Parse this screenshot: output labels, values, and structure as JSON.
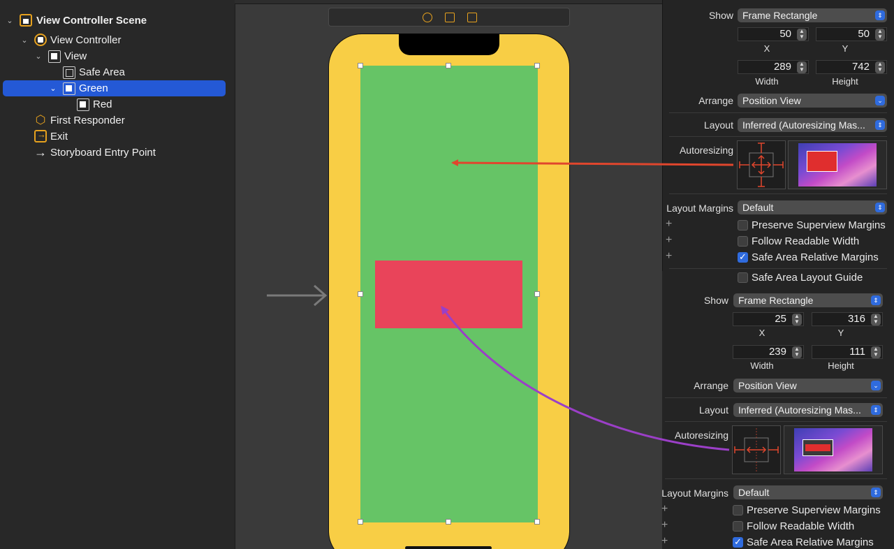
{
  "outline": {
    "items": [
      {
        "label": "View Controller Scene",
        "icon": "scene-icon",
        "chevron": "down"
      },
      {
        "label": "View Controller",
        "icon": "view-controller-icon",
        "chevron": "down"
      },
      {
        "label": "View",
        "icon": "view-icon",
        "chevron": "down"
      },
      {
        "label": "Safe Area",
        "icon": "safe-area-icon"
      },
      {
        "label": "Green",
        "icon": "view-icon",
        "chevron": "down",
        "selected": true
      },
      {
        "label": "Red",
        "icon": "view-icon"
      },
      {
        "label": "First Responder",
        "icon": "cube-icon"
      },
      {
        "label": "Exit",
        "icon": "exit-icon"
      },
      {
        "label": "Storyboard Entry Point",
        "icon": "arrow-right-icon"
      }
    ]
  },
  "canvas": {
    "background_color": "#f8ce45",
    "green_color": "#66c466",
    "red_color": "#e9445a",
    "arrow_colors": {
      "orange": "#e0462d",
      "purple": "#9b3fc7"
    }
  },
  "inspector1": {
    "show_label": "Show",
    "show_value": "Frame Rectangle",
    "x": "50",
    "y": "50",
    "width": "289",
    "height": "742",
    "x_label": "X",
    "y_label": "Y",
    "width_label": "Width",
    "height_label": "Height",
    "arrange_label": "Arrange",
    "arrange_value": "Position View",
    "layout_label": "Layout",
    "layout_value": "Inferred (Autoresizing Mas...",
    "autoresizing_label": "Autoresizing",
    "layout_margins_label": "Layout Margins",
    "layout_margins_value": "Default",
    "preserve_label": "Preserve Superview Margins",
    "readable_label": "Follow Readable Width",
    "safe_rel_label": "Safe Area Relative Margins",
    "safe_guide_label": "Safe Area Layout Guide",
    "safe_rel_checked": true
  },
  "inspector2": {
    "show_label": "Show",
    "show_value": "Frame Rectangle",
    "x": "25",
    "y": "316",
    "width": "239",
    "height": "111",
    "x_label": "X",
    "y_label": "Y",
    "width_label": "Width",
    "height_label": "Height",
    "arrange_label": "Arrange",
    "arrange_value": "Position View",
    "layout_label": "Layout",
    "layout_value": "Inferred (Autoresizing Mas...",
    "autoresizing_label": "Autoresizing",
    "layout_margins_label": "Layout Margins",
    "layout_margins_value": "Default",
    "preserve_label": "Preserve Superview Margins",
    "readable_label": "Follow Readable Width",
    "safe_rel_label": "Safe Area Relative Margins",
    "safe_rel_checked": true
  }
}
